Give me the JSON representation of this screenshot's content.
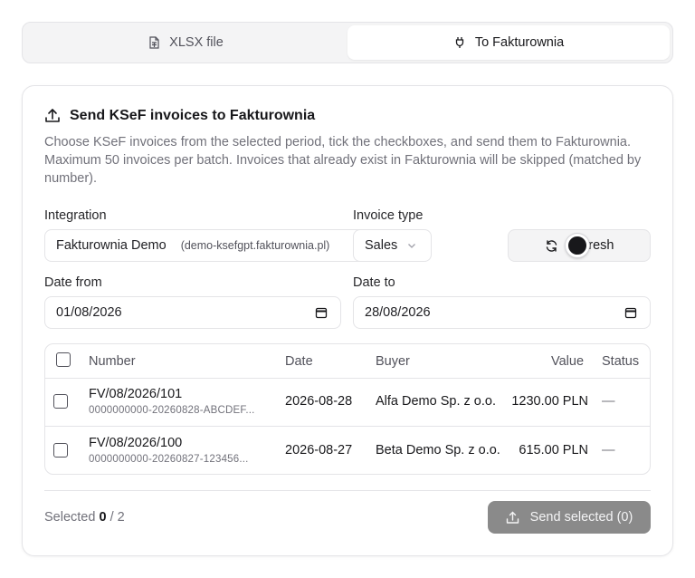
{
  "tabs": [
    {
      "label": "XLSX file",
      "icon": "spreadsheet-icon"
    },
    {
      "label": "To Fakturownia",
      "icon": "plug-icon"
    }
  ],
  "card": {
    "title": "Send KSeF invoices to Fakturownia",
    "description": "Choose KSeF invoices from the selected period, tick the checkboxes, and send them to Fakturownia. Maximum 50 invoices per batch. Invoices that already exist in Fakturownia will be skipped (matched by number)."
  },
  "form": {
    "integration_label": "Integration",
    "integration_value": "Fakturownia Demo",
    "integration_domain": "(demo-ksefgpt.fakturownia.pl)",
    "invoice_type_label": "Invoice type",
    "invoice_type_value": "Sales",
    "refresh_label": "Refresh",
    "refresh_visible_suffix": "resh",
    "date_from_label": "Date from",
    "date_from_value": "01/08/2026",
    "date_to_label": "Date to",
    "date_to_value": "28/08/2026"
  },
  "table": {
    "headers": [
      "Number",
      "Date",
      "Buyer",
      "Value",
      "Status"
    ],
    "rows": [
      {
        "number": "FV/08/2026/101",
        "ksef_id": "0000000000-20260828-ABCDEF...",
        "date": "2026-08-28",
        "buyer": "Alfa Demo Sp. z o.o.",
        "value": "1230.00 PLN",
        "status": "—"
      },
      {
        "number": "FV/08/2026/100",
        "ksef_id": "0000000000-20260827-123456...",
        "date": "2026-08-27",
        "buyer": "Beta Demo Sp. z o.o.",
        "value": "615.00 PLN",
        "status": "—"
      }
    ]
  },
  "footer": {
    "selected_prefix": "Selected",
    "selected_count": "0",
    "selected_sep": "/",
    "selected_total": "2",
    "send_label": "Send selected (0)"
  },
  "colors": {
    "border": "#e4e4e7",
    "muted_text": "#71717a",
    "disabled_button": "#8a8a8a"
  }
}
